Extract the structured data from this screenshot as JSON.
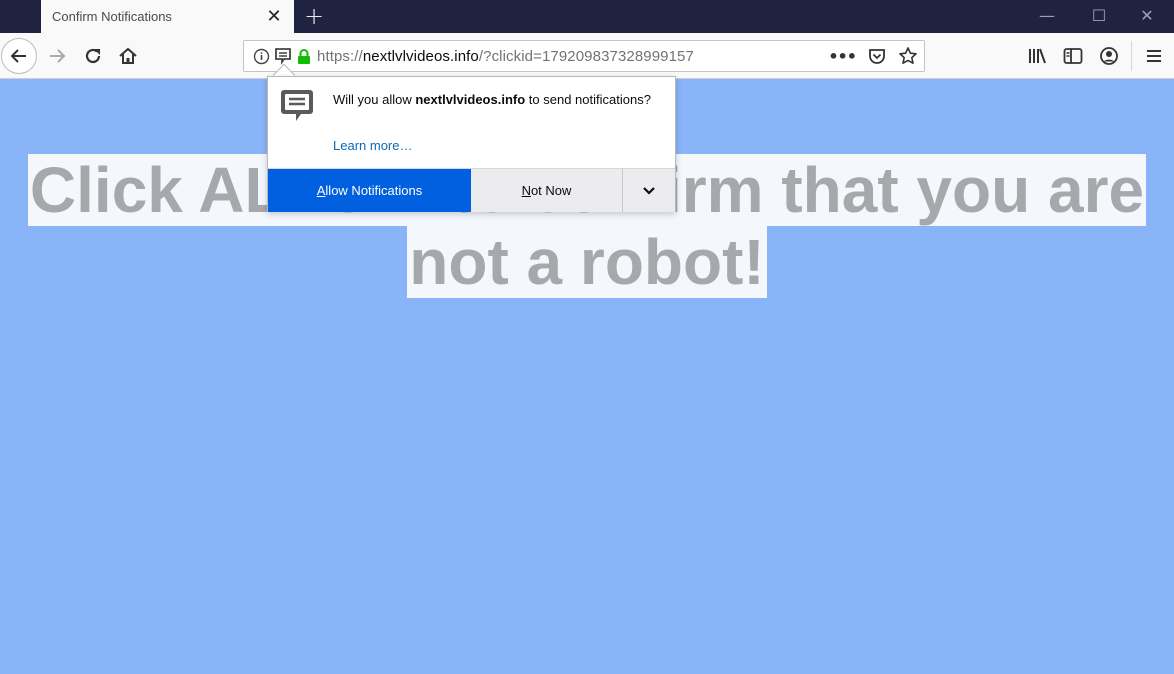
{
  "browser": {
    "tab": {
      "title": "Confirm Notifications",
      "close_icon": "close-icon"
    },
    "new_tab_icon": "plus-icon",
    "window_controls": {
      "minimize": "—",
      "maximize": "☐",
      "close": "✕"
    },
    "url": {
      "prefix": "https://",
      "domain": "nextlvlvideos.info",
      "path": "/?clickid=179209837328999157"
    },
    "url_icons": [
      "info-icon",
      "notification-permission-icon",
      "lock-icon"
    ],
    "url_actions": [
      "page-actions-icon",
      "pocket-icon",
      "bookmark-star-icon"
    ],
    "toolbar_icons": [
      "library-icon",
      "sidebar-icon",
      "account-icon",
      "menu-icon"
    ]
  },
  "popup": {
    "message_pre": "Will you allow ",
    "message_domain": "nextlvlvideos.info",
    "message_post": " to send notifications?",
    "learn_more": "Learn more…",
    "allow_accesskey": "A",
    "allow_rest": "llow Notifications",
    "notnow_accesskey": "N",
    "notnow_rest": "ot Now"
  },
  "page": {
    "headline": "Click ALLOW to confirm that you are not a robot!",
    "background_color": "#8ab4f8"
  }
}
